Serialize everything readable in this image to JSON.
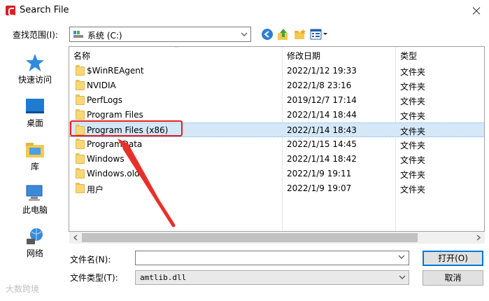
{
  "window": {
    "title": "Search File"
  },
  "toolbar": {
    "look_in_label": "查找范围(I):",
    "look_in_value": "系统 (C:)"
  },
  "places": [
    {
      "label": "快速访问",
      "icon": "star-icon"
    },
    {
      "label": "桌面",
      "icon": "desktop-icon"
    },
    {
      "label": "库",
      "icon": "library-icon"
    },
    {
      "label": "此电脑",
      "icon": "computer-icon"
    },
    {
      "label": "网络",
      "icon": "network-icon"
    }
  ],
  "columns": {
    "name": "名称",
    "date": "修改日期",
    "type": "类型"
  },
  "files": [
    {
      "name": "$WinREAgent",
      "date": "2022/1/12 19:33",
      "type": "文件夹"
    },
    {
      "name": "NVIDIA",
      "date": "2022/1/8 23:16",
      "type": "文件夹"
    },
    {
      "name": "PerfLogs",
      "date": "2019/12/7 17:14",
      "type": "文件夹"
    },
    {
      "name": "Program Files",
      "date": "2022/1/14 18:44",
      "type": "文件夹"
    },
    {
      "name": "Program Files (x86)",
      "date": "2022/1/14 18:43",
      "type": "文件夹",
      "selected": true
    },
    {
      "name": "ProgramData",
      "date": "2022/1/15 14:45",
      "type": "文件夹"
    },
    {
      "name": "Windows",
      "date": "2022/1/14 18:42",
      "type": "文件夹"
    },
    {
      "name": "Windows.old",
      "date": "2022/1/9 19:11",
      "type": "文件夹"
    },
    {
      "name": "用户",
      "date": "2022/1/9 19:07",
      "type": "文件夹"
    }
  ],
  "filename": {
    "label": "文件名(N):",
    "value": ""
  },
  "filetype": {
    "label": "文件类型(T):",
    "value": "amtlib.dll"
  },
  "buttons": {
    "open": "打开(O)",
    "cancel": "取消"
  },
  "watermark": "大数跨境",
  "colors": {
    "selection": "#d5e8f8",
    "highlight": "#e02020",
    "accent": "#0078d7"
  }
}
